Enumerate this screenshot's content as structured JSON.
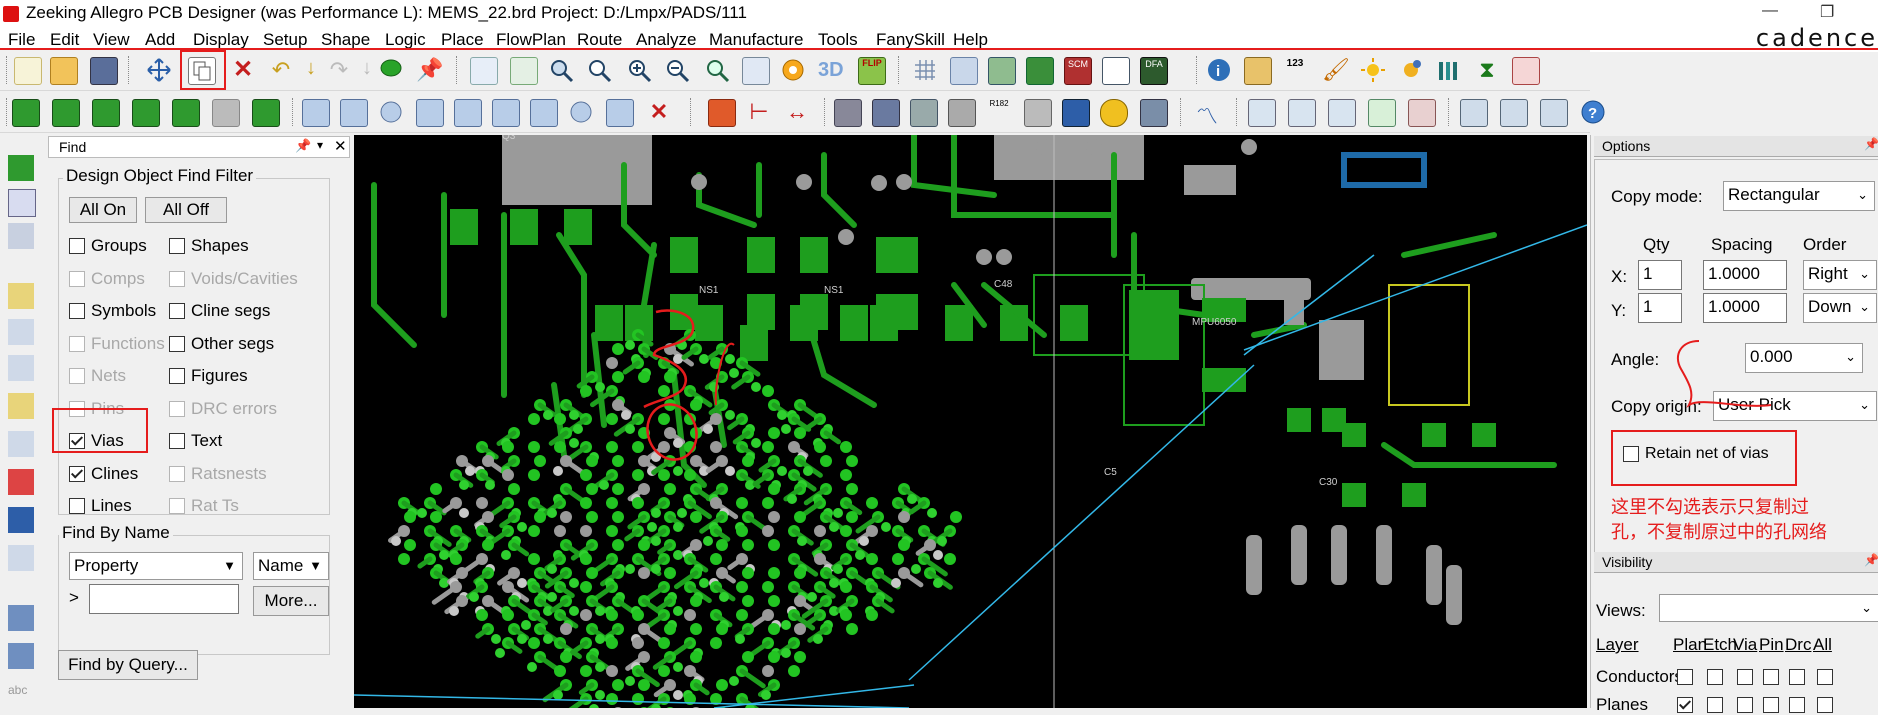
{
  "window": {
    "title": "Zeeking Allegro PCB Designer (was Performance L): MEMS_22.brd  Project: D:/Lmpx/PADS/111",
    "brand": "cadence",
    "minimize_glyph": "—",
    "restore_glyph": "❐"
  },
  "menu": [
    "File",
    "Edit",
    "View",
    "Add",
    "Display",
    "Setup",
    "Shape",
    "Logic",
    "Place",
    "FlowPlan",
    "Route",
    "Analyze",
    "Manufacture",
    "Tools",
    "FanySkill",
    "Help"
  ],
  "toolbar": {
    "copy_tool_highlighted": true,
    "icon_3d_label": "3D",
    "icon_flip_label": "FLIP",
    "icon_scm_label": "SCM",
    "icon_dfa_label": "DFA",
    "icon_123_label": "123",
    "icon_r182_label": "R182"
  },
  "find": {
    "panel_title": "Find",
    "group_title": "Design Object Find Filter",
    "all_on": "All On",
    "all_off": "All Off",
    "filters": [
      {
        "label": "Groups",
        "checked": false,
        "enabled": true
      },
      {
        "label": "Shapes",
        "checked": false,
        "enabled": true
      },
      {
        "label": "Comps",
        "checked": false,
        "enabled": false
      },
      {
        "label": "Voids/Cavities",
        "checked": false,
        "enabled": false
      },
      {
        "label": "Symbols",
        "checked": false,
        "enabled": true
      },
      {
        "label": "Cline segs",
        "checked": false,
        "enabled": true
      },
      {
        "label": "Functions",
        "checked": false,
        "enabled": false
      },
      {
        "label": "Other segs",
        "checked": false,
        "enabled": true
      },
      {
        "label": "Nets",
        "checked": false,
        "enabled": false
      },
      {
        "label": "Figures",
        "checked": false,
        "enabled": true
      },
      {
        "label": "Pins",
        "checked": false,
        "enabled": false
      },
      {
        "label": "DRC errors",
        "checked": false,
        "enabled": false
      },
      {
        "label": "Vias",
        "checked": true,
        "enabled": true
      },
      {
        "label": "Text",
        "checked": false,
        "enabled": true
      },
      {
        "label": "Clines",
        "checked": true,
        "enabled": true
      },
      {
        "label": "Ratsnests",
        "checked": false,
        "enabled": false
      },
      {
        "label": "Lines",
        "checked": false,
        "enabled": true
      },
      {
        "label": "Rat Ts",
        "checked": false,
        "enabled": false
      }
    ],
    "find_by_name_title": "Find By Name",
    "property_select": "Property",
    "name_select": "Name",
    "name_input": "",
    "more_button": "More...",
    "query_button": "Find by Query...",
    "chevron": ">"
  },
  "options": {
    "panel_title": "Options",
    "copy_mode_label": "Copy mode:",
    "copy_mode_value": "Rectangular",
    "qty_header": "Qty",
    "spacing_header": "Spacing",
    "order_header": "Order",
    "x_label": "X:",
    "y_label": "Y:",
    "x_qty": "1",
    "y_qty": "1",
    "x_spacing": "1.0000",
    "y_spacing": "1.0000",
    "x_order": "Right",
    "y_order": "Down",
    "angle_label": "Angle:",
    "angle_value": "0.000",
    "copy_origin_label": "Copy origin:",
    "copy_origin_value": "User Pick",
    "retain_label": "Retain net of vias",
    "retain_checked": false,
    "annotation_line1": "这里不勾选表示只复制过",
    "annotation_line2": "孔，不复制原过中的孔网络"
  },
  "visibility": {
    "panel_title": "Visibility",
    "views_label": "Views:",
    "views_value": "",
    "layer_header": "Layer",
    "columns": [
      "Plan",
      "Etch",
      "Via",
      "Pin",
      "Drc",
      "All"
    ],
    "rows": [
      {
        "name": "Conductors",
        "checks": [
          false,
          false,
          false,
          false,
          false,
          false
        ]
      },
      {
        "name": "Planes",
        "checks": [
          true,
          false,
          false,
          false,
          false,
          false
        ]
      }
    ]
  },
  "canvas": {
    "silk_labels": [
      "Q3",
      "C48",
      "NS1",
      "NS1",
      "MPU6050",
      "C5",
      "C30"
    ]
  },
  "colors": {
    "pcb_background": "#000000",
    "etch_green": "#1e9e1e",
    "via_green": "#22c422",
    "pad_gray": "#9a9a9a",
    "rats_cyan": "#33b8e8",
    "annotation_red": "#e51c1c"
  }
}
